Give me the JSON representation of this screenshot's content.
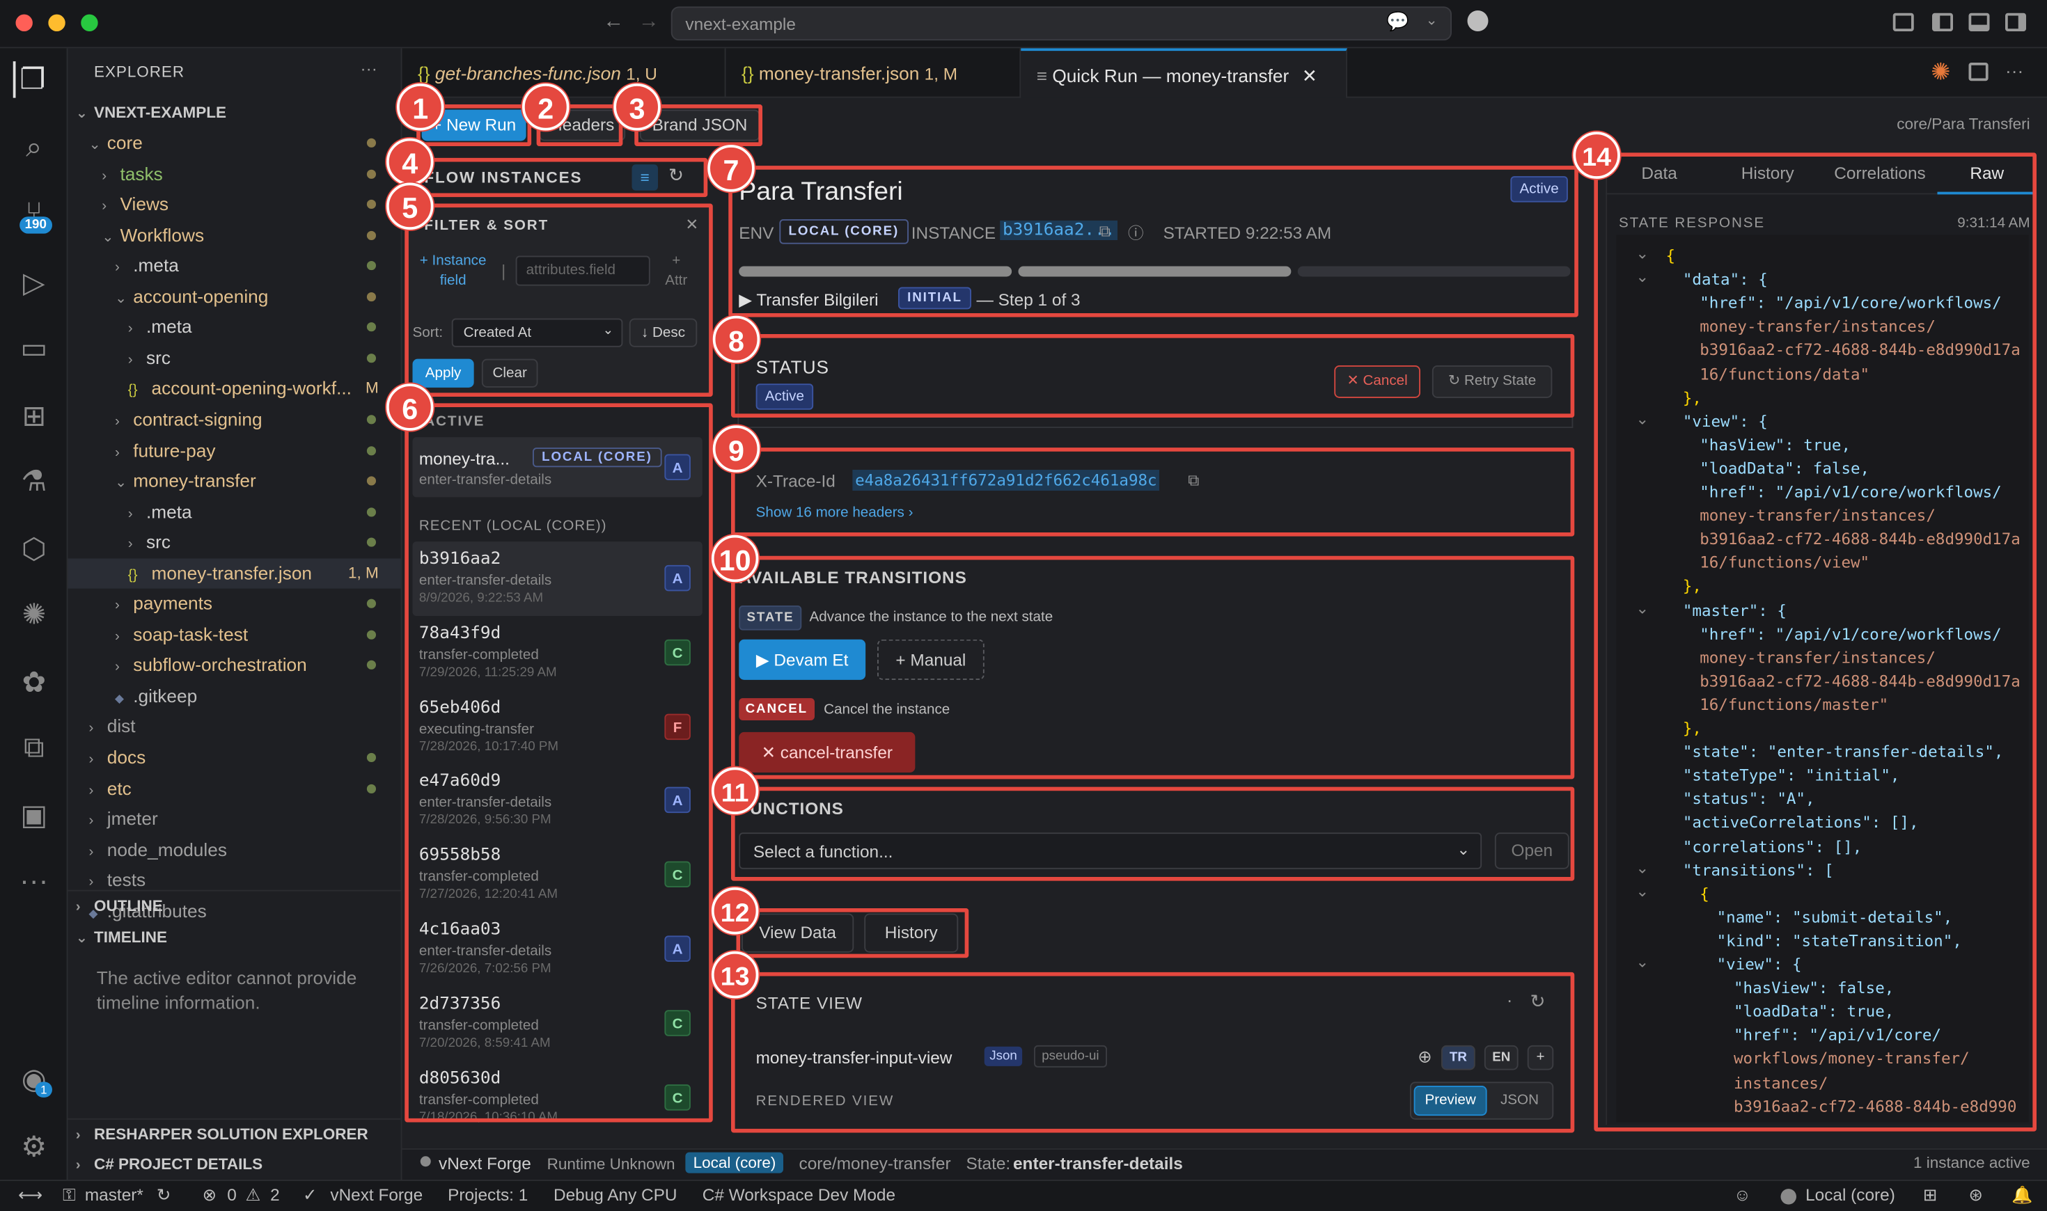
{
  "window": {
    "search_text": "vnext-example"
  },
  "colors": {
    "accent": "#1f8ad2",
    "highlight": "#e5483f",
    "active": "#24366b"
  },
  "activity_bar": {
    "scm_badge": "190",
    "account_badge": "1"
  },
  "explorer": {
    "title": "EXPLORER",
    "more": "···",
    "root": "VNEXT-EXAMPLE",
    "items": [
      {
        "label": "core",
        "indent": 1,
        "type": "folder-open"
      },
      {
        "label": "tasks",
        "indent": 2,
        "type": "folder"
      },
      {
        "label": "Views",
        "indent": 2,
        "type": "folder"
      },
      {
        "label": "Workflows",
        "indent": 2,
        "type": "folder-open"
      },
      {
        "label": ".meta",
        "indent": 3,
        "type": "folder"
      },
      {
        "label": "account-opening",
        "indent": 3,
        "type": "folder-open"
      },
      {
        "label": ".meta",
        "indent": 4,
        "type": "folder"
      },
      {
        "label": "src",
        "indent": 4,
        "type": "folder"
      },
      {
        "label": "account-opening-workf...",
        "indent": 4,
        "type": "json",
        "status": "M"
      },
      {
        "label": "contract-signing",
        "indent": 3,
        "type": "folder"
      },
      {
        "label": "future-pay",
        "indent": 3,
        "type": "folder"
      },
      {
        "label": "money-transfer",
        "indent": 3,
        "type": "folder-open"
      },
      {
        "label": ".meta",
        "indent": 4,
        "type": "folder"
      },
      {
        "label": "src",
        "indent": 4,
        "type": "folder"
      },
      {
        "label": "money-transfer.json",
        "indent": 4,
        "type": "json",
        "status": "1, M"
      },
      {
        "label": "payments",
        "indent": 3,
        "type": "folder"
      },
      {
        "label": "soap-task-test",
        "indent": 3,
        "type": "folder"
      },
      {
        "label": "subflow-orchestration",
        "indent": 3,
        "type": "folder"
      },
      {
        "label": ".gitkeep",
        "indent": 3,
        "type": "file"
      },
      {
        "label": "dist",
        "indent": 1,
        "type": "folder"
      },
      {
        "label": "docs",
        "indent": 1,
        "type": "folder"
      },
      {
        "label": "etc",
        "indent": 1,
        "type": "folder"
      },
      {
        "label": "jmeter",
        "indent": 1,
        "type": "folder"
      },
      {
        "label": "node_modules",
        "indent": 1,
        "type": "folder"
      },
      {
        "label": "tests",
        "indent": 1,
        "type": "folder"
      },
      {
        "label": ".gitattributes",
        "indent": 1,
        "type": "file"
      }
    ],
    "outline": "OUTLINE",
    "timeline": "TIMELINE",
    "timeline_msg": "The active editor cannot provide timeline information.",
    "resharper": "RESHARPER SOLUTION EXPLORER",
    "csharp": "C# PROJECT DETAILS"
  },
  "tabs": [
    {
      "label": "get-branches-func.json",
      "status": "1, U"
    },
    {
      "label": "money-transfer.json",
      "status": "1, M"
    },
    {
      "label": "Quick Run — money-transfer",
      "status": ""
    }
  ],
  "toolbar": {
    "new_run": "+ New Run",
    "headers": "Headers",
    "brand_json": "Brand JSON",
    "path": "core/Para Transferi"
  },
  "flow": {
    "title": "FLOW INSTANCES",
    "filter_title": "FILTER & SORT",
    "add_field": "+ Instance field",
    "attr_placeholder": "attributes.field",
    "add_attr": "+ Attr",
    "sort_label": "Sort:",
    "sort_value": "Created At",
    "desc": "↓ Desc",
    "apply": "Apply",
    "clear": "Clear",
    "active_title": "ACTIVE",
    "active_item": {
      "id": "money-tra...",
      "env": "LOCAL (CORE)",
      "state": "enter-transfer-details",
      "status": "A"
    },
    "recent_title": "RECENT (LOCAL (CORE))",
    "recent": [
      {
        "id": "b3916aa2",
        "state": "enter-transfer-details",
        "date": "8/9/2026, 9:22:53 AM",
        "status": "A"
      },
      {
        "id": "78a43f9d",
        "state": "transfer-completed",
        "date": "7/29/2026, 11:25:29 AM",
        "status": "C"
      },
      {
        "id": "65eb406d",
        "state": "executing-transfer",
        "date": "7/28/2026, 10:17:40 PM",
        "status": "F"
      },
      {
        "id": "e47a60d9",
        "state": "enter-transfer-details",
        "date": "7/28/2026, 9:56:30 PM",
        "status": "A"
      },
      {
        "id": "69558b58",
        "state": "transfer-completed",
        "date": "7/27/2026, 12:20:41 AM",
        "status": "C"
      },
      {
        "id": "4c16aa03",
        "state": "enter-transfer-details",
        "date": "7/26/2026, 7:02:56 PM",
        "status": "A"
      },
      {
        "id": "2d737356",
        "state": "transfer-completed",
        "date": "7/20/2026, 8:59:41 AM",
        "status": "C"
      },
      {
        "id": "d805630d",
        "state": "transfer-completed",
        "date": "7/18/2026, 10:36:10 AM",
        "status": "C"
      }
    ]
  },
  "instance": {
    "title": "Para Transferi",
    "status": "Active",
    "env_label": "ENV",
    "env": "LOCAL (CORE)",
    "instance_label": "INSTANCE",
    "instance_id": "b3916aa2...",
    "started": "STARTED 9:22:53 AM",
    "progress": [
      1,
      1,
      0
    ],
    "step_name": "▶ Transfer Bilgileri",
    "step_tag": "INITIAL",
    "step_text": "— Step 1 of 3"
  },
  "status_panel": {
    "title": "STATUS",
    "value": "Active",
    "cancel": "✕ Cancel",
    "retry": "↻ Retry State"
  },
  "trace": {
    "label": "X-Trace-Id",
    "value": "e4a8a26431ff672a91d2f662c461a98c",
    "more": "Show 16 more headers ›"
  },
  "transitions": {
    "title": "AVAILABLE TRANSITIONS",
    "state_tag": "STATE",
    "state_desc": "Advance the instance to the next state",
    "devam": "▶ Devam Et",
    "manual": "+ Manual",
    "cancel_tag": "CANCEL",
    "cancel_desc": "Cancel the instance",
    "cancel_btn": "✕ cancel-transfer"
  },
  "functions": {
    "title": "FUNCTIONS",
    "placeholder": "Select a function...",
    "open": "Open"
  },
  "bottom_tabs": {
    "view_data": "View Data",
    "history": "History"
  },
  "state_view": {
    "title": "STATE VIEW",
    "dot": "·",
    "view_name": "money-transfer-input-view",
    "json_tag": "Json",
    "pseudo_tag": "pseudo-ui",
    "lang_tr": "TR",
    "lang_en": "EN",
    "lang_add": "+",
    "rendered": "RENDERED VIEW",
    "preview": "Preview",
    "json": "JSON"
  },
  "right": {
    "tabs": [
      "Data",
      "History",
      "Correlations",
      "Raw"
    ],
    "state_response": "STATE RESPONSE",
    "time": "9:31:14 AM",
    "json_lines": [
      {
        "i": 0,
        "t": "{",
        "c": "p"
      },
      {
        "i": 1,
        "t": "\"data\": {",
        "c": "k"
      },
      {
        "i": 2,
        "t": "\"href\": \"/api/v1/core/workflows/",
        "c": "s"
      },
      {
        "i": 2,
        "t": "money-transfer/instances/",
        "c": "s2"
      },
      {
        "i": 2,
        "t": "b3916aa2-cf72-4688-844b-e8d990d17a",
        "c": "s2"
      },
      {
        "i": 2,
        "t": "16/functions/data\"",
        "c": "s2"
      },
      {
        "i": 1,
        "t": "},",
        "c": "p"
      },
      {
        "i": 1,
        "t": "\"view\": {",
        "c": "k"
      },
      {
        "i": 2,
        "t": "\"hasView\": true,",
        "c": "b"
      },
      {
        "i": 2,
        "t": "\"loadData\": false,",
        "c": "b"
      },
      {
        "i": 2,
        "t": "\"href\": \"/api/v1/core/workflows/",
        "c": "s"
      },
      {
        "i": 2,
        "t": "money-transfer/instances/",
        "c": "s2"
      },
      {
        "i": 2,
        "t": "b3916aa2-cf72-4688-844b-e8d990d17a",
        "c": "s2"
      },
      {
        "i": 2,
        "t": "16/functions/view\"",
        "c": "s2"
      },
      {
        "i": 1,
        "t": "},",
        "c": "p"
      },
      {
        "i": 1,
        "t": "\"master\": {",
        "c": "k"
      },
      {
        "i": 2,
        "t": "\"href\": \"/api/v1/core/workflows/",
        "c": "s"
      },
      {
        "i": 2,
        "t": "money-transfer/instances/",
        "c": "s2"
      },
      {
        "i": 2,
        "t": "b3916aa2-cf72-4688-844b-e8d990d17a",
        "c": "s2"
      },
      {
        "i": 2,
        "t": "16/functions/master\"",
        "c": "s2"
      },
      {
        "i": 1,
        "t": "},",
        "c": "p"
      },
      {
        "i": 1,
        "t": "\"state\": \"enter-transfer-details\",",
        "c": "s"
      },
      {
        "i": 1,
        "t": "\"stateType\": \"initial\",",
        "c": "s"
      },
      {
        "i": 1,
        "t": "\"status\": \"A\",",
        "c": "s"
      },
      {
        "i": 1,
        "t": "\"activeCorrelations\": [],",
        "c": "k"
      },
      {
        "i": 1,
        "t": "\"correlations\": [],",
        "c": "k"
      },
      {
        "i": 1,
        "t": "\"transitions\": [",
        "c": "k"
      },
      {
        "i": 2,
        "t": "{",
        "c": "p"
      },
      {
        "i": 3,
        "t": "\"name\": \"submit-details\",",
        "c": "s"
      },
      {
        "i": 3,
        "t": "\"kind\": \"stateTransition\",",
        "c": "s"
      },
      {
        "i": 3,
        "t": "\"view\": {",
        "c": "k"
      },
      {
        "i": 4,
        "t": "\"hasView\": false,",
        "c": "b"
      },
      {
        "i": 4,
        "t": "\"loadData\": true,",
        "c": "b"
      },
      {
        "i": 4,
        "t": "\"href\": \"/api/v1/core/",
        "c": "s"
      },
      {
        "i": 4,
        "t": "workflows/money-transfer/",
        "c": "s2"
      },
      {
        "i": 4,
        "t": "instances/",
        "c": "s2"
      },
      {
        "i": 4,
        "t": "b3916aa2-cf72-4688-844b-e8d990",
        "c": "s2"
      }
    ]
  },
  "footer": {
    "forge": "vNext Forge",
    "runtime": "Runtime Unknown",
    "env": "Local (core)",
    "path": "core/money-transfer",
    "state_label": "State:",
    "state": "enter-transfer-details",
    "count": "1 instance active"
  },
  "statusbar": {
    "branch": "master*",
    "errors": "0",
    "warnings": "2",
    "forge": "vNext Forge",
    "projects": "Projects: 1",
    "debug": "Debug Any CPU",
    "workspace": "C# Workspace Dev Mode",
    "local": "Local (core)"
  },
  "annotations": [
    "1",
    "2",
    "3",
    "4",
    "5",
    "6",
    "7",
    "8",
    "9",
    "10",
    "11",
    "12",
    "13",
    "14"
  ]
}
